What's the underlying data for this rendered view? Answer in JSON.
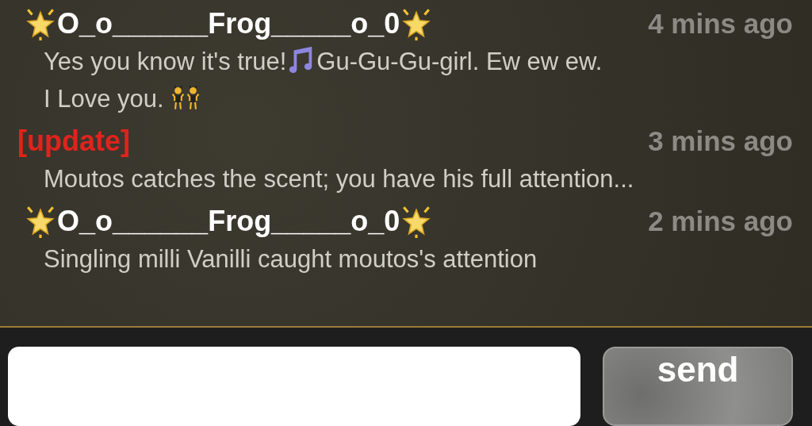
{
  "messages": [
    {
      "kind": "user",
      "name": "O_o______Frog_____o_0",
      "time": "4 mins ago",
      "body": [
        {
          "kind": "text",
          "text": "Yes you know it's true!"
        },
        {
          "kind": "note"
        },
        {
          "kind": "text",
          "text": "Gu-Gu-Gu-girl. Ew ew ew."
        },
        {
          "kind": "break"
        },
        {
          "kind": "text",
          "text": "I Love you. "
        },
        {
          "kind": "dancers"
        }
      ]
    },
    {
      "kind": "update",
      "name": "[update]",
      "time": "3 mins ago",
      "body": [
        {
          "kind": "text",
          "text": "Moutos catches the scent; you have his full attention..."
        }
      ]
    },
    {
      "kind": "user",
      "name": "O_o______Frog_____o_0",
      "time": "2 mins ago",
      "body": [
        {
          "kind": "text",
          "text": "Singling milli Vanilli caught moutos's attention"
        }
      ]
    }
  ],
  "composer": {
    "send": "send"
  }
}
